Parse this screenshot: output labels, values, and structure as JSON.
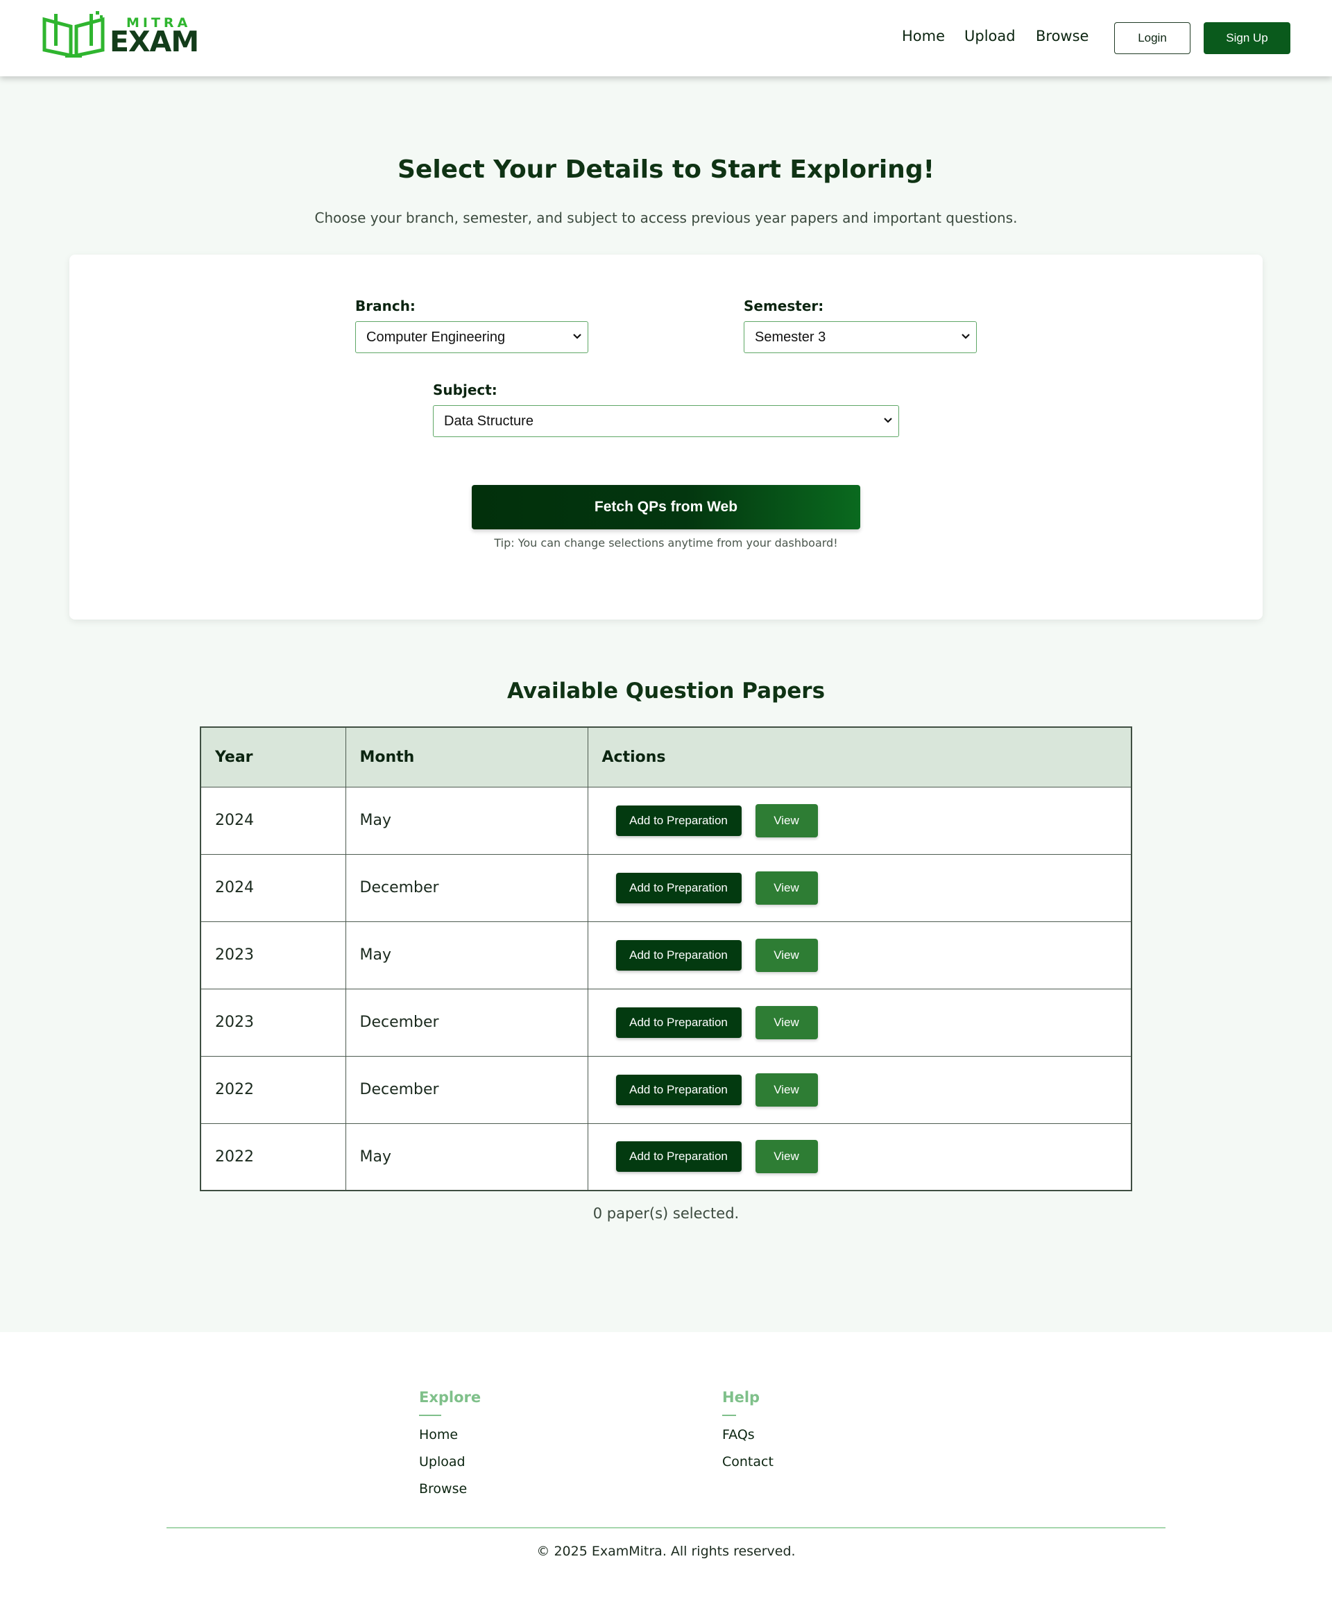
{
  "header": {
    "logo_top": "MITRA",
    "logo_bottom": "EXAM",
    "nav": {
      "home": "Home",
      "upload": "Upload",
      "browse": "Browse"
    },
    "login": "Login",
    "signup": "Sign Up"
  },
  "hero": {
    "title": "Select Your Details to Start Exploring!",
    "subtitle": "Choose your branch, semester, and subject to access previous year papers and important questions."
  },
  "form": {
    "branch_label": "Branch:",
    "branch_value": "Computer Engineering",
    "semester_label": "Semester:",
    "semester_value": "Semester 3",
    "subject_label": "Subject:",
    "subject_value": "Data Structure",
    "fetch_button": "Fetch QPs from Web",
    "tip": "Tip: You can change selections anytime from your dashboard!"
  },
  "papers": {
    "title": "Available Question Papers",
    "columns": [
      "Year",
      "Month",
      "Actions"
    ],
    "rows": [
      {
        "year": "2024",
        "month": "May"
      },
      {
        "year": "2024",
        "month": "December"
      },
      {
        "year": "2023",
        "month": "May"
      },
      {
        "year": "2023",
        "month": "December"
      },
      {
        "year": "2022",
        "month": "December"
      },
      {
        "year": "2022",
        "month": "May"
      }
    ],
    "add_label": "Add to Preparation",
    "view_label": "View",
    "selected_text": "0 paper(s) selected."
  },
  "footer": {
    "explore_heading": "Explore",
    "explore_links": [
      "Home",
      "Upload",
      "Browse"
    ],
    "help_heading": "Help",
    "help_links": [
      "FAQs",
      "Contact"
    ],
    "copyright": "© 2025 ExamMitra. All rights reserved."
  },
  "colors": {
    "primary": "#0a5a1c",
    "accent": "#2fb52f",
    "view_button": "#2e7d34",
    "page_bg": "#f4f9f5"
  },
  "icons": {
    "logo": "open-book-icon",
    "select_arrow": "chevron-down-icon"
  }
}
